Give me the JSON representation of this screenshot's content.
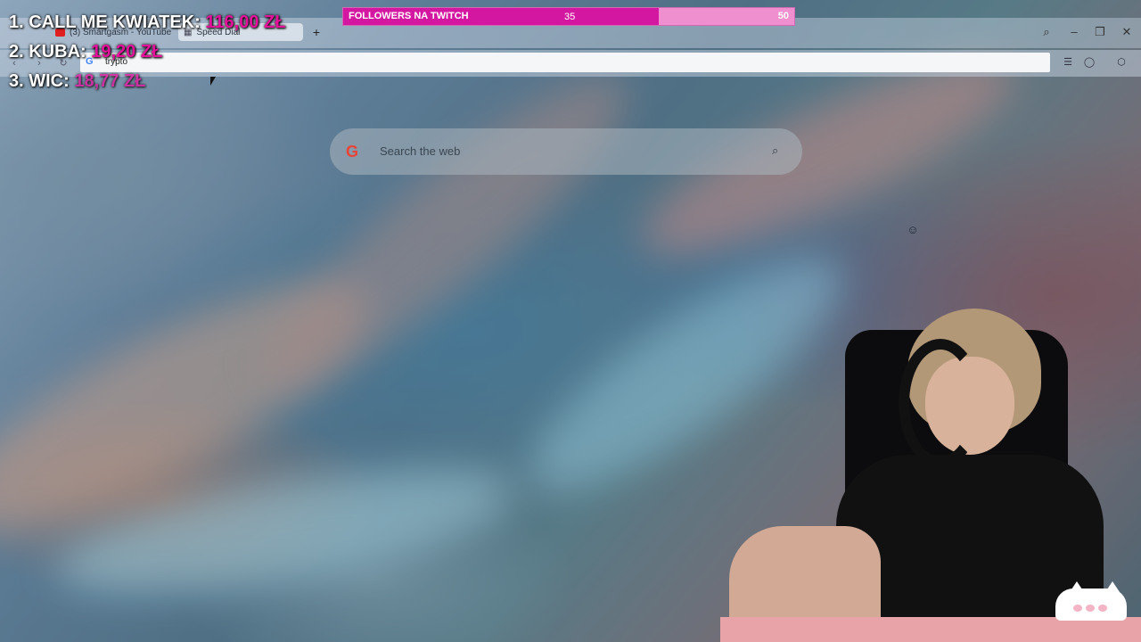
{
  "overlay": {
    "leaderboard": [
      {
        "rank_name": "1. CALL ME KWIATEK:",
        "amount": "116,00 ZŁ"
      },
      {
        "rank_name": "2. KUBA:",
        "amount": "19,20 ZŁ"
      },
      {
        "rank_name": "3. WIC:",
        "amount": "18,77 ZŁ"
      }
    ],
    "goal": {
      "title": "FOLLOWERS NA TWITCH",
      "current": "35",
      "max": "50",
      "progress_fraction": 0.7,
      "fill_color": "#d417a0",
      "track_color": "#ef8fcf"
    },
    "accent_color": "#e4129b"
  },
  "browser": {
    "tabs": [
      {
        "label": "(3) Smartgasm - YouTube",
        "icon": "youtube-icon"
      },
      {
        "label": "Speed Dial",
        "icon": "speed-dial-icon"
      }
    ],
    "new_tab_label": "+",
    "address": {
      "value": "trypto",
      "engine_icon": "google-icon"
    },
    "search": {
      "placeholder": "Search the web",
      "logo": "G"
    }
  }
}
